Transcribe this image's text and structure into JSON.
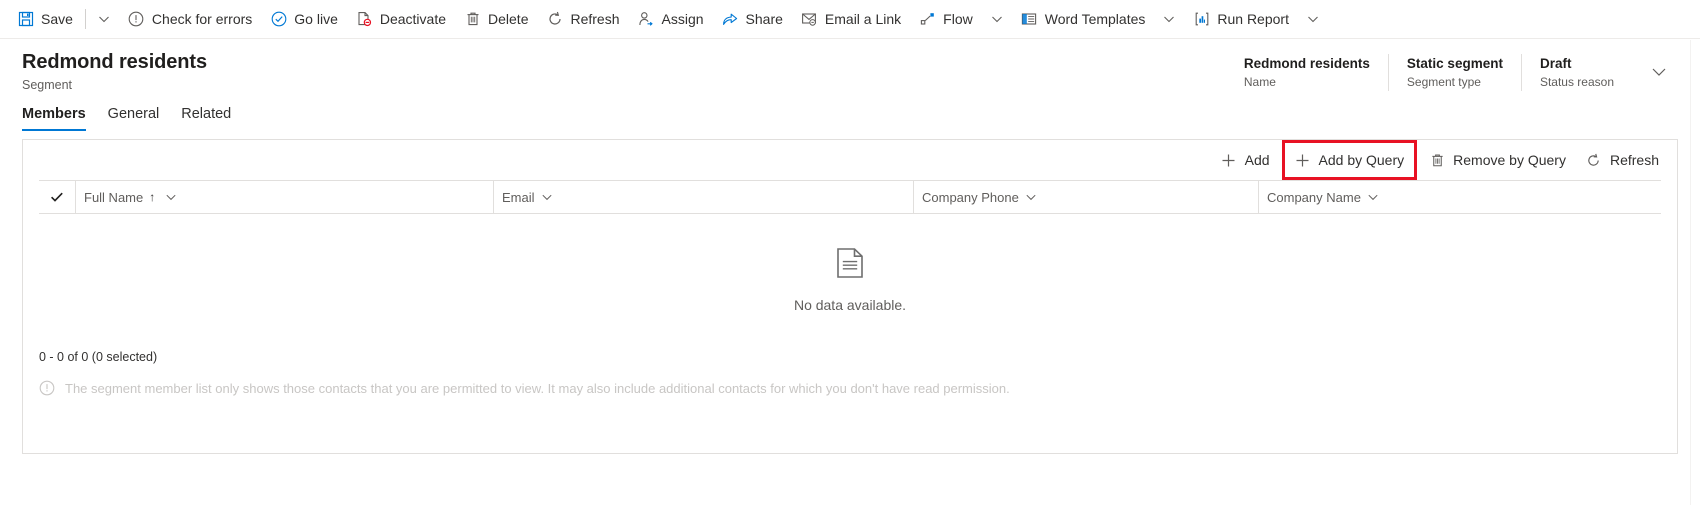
{
  "commandbar": {
    "items": [
      {
        "label": "Save",
        "icon": "save-icon"
      },
      {
        "label": "Check for errors",
        "icon": "error-circle-icon"
      },
      {
        "label": "Go live",
        "icon": "checkmark-circle-icon"
      },
      {
        "label": "Deactivate",
        "icon": "deactivate-page-icon"
      },
      {
        "label": "Delete",
        "icon": "trash-icon"
      },
      {
        "label": "Refresh",
        "icon": "refresh-icon"
      },
      {
        "label": "Assign",
        "icon": "assign-person-icon"
      },
      {
        "label": "Share",
        "icon": "share-icon"
      },
      {
        "label": "Email a Link",
        "icon": "email-link-icon"
      },
      {
        "label": "Flow",
        "icon": "flow-icon"
      },
      {
        "label": "Word Templates",
        "icon": "word-template-icon"
      },
      {
        "label": "Run Report",
        "icon": "report-chart-icon"
      }
    ]
  },
  "record": {
    "title": "Redmond residents",
    "subtitle": "Segment",
    "header_fields": [
      {
        "value": "Redmond residents",
        "label": "Name"
      },
      {
        "value": "Static segment",
        "label": "Segment type"
      },
      {
        "value": "Draft",
        "label": "Status reason"
      }
    ]
  },
  "tabs": [
    {
      "label": "Members",
      "active": true
    },
    {
      "label": "General",
      "active": false
    },
    {
      "label": "Related",
      "active": false
    }
  ],
  "grid": {
    "commands": [
      {
        "label": "Add",
        "icon": "plus-icon",
        "highlighted": false
      },
      {
        "label": "Add by Query",
        "icon": "plus-icon",
        "highlighted": true
      },
      {
        "label": "Remove by Query",
        "icon": "trash-icon",
        "highlighted": false
      },
      {
        "label": "Refresh",
        "icon": "refresh-icon",
        "highlighted": false
      }
    ],
    "columns": [
      {
        "label": "Full Name",
        "sorted": true,
        "sort_direction": "asc"
      },
      {
        "label": "Email",
        "sorted": false,
        "sort_direction": ""
      },
      {
        "label": "Company Phone",
        "sorted": false,
        "sort_direction": ""
      },
      {
        "label": "Company Name",
        "sorted": false,
        "sort_direction": ""
      }
    ],
    "rows": [],
    "empty_text": "No data available.",
    "pager_text": "0 - 0 of 0 (0 selected)",
    "notice_text": "The segment member list only shows those contacts that you are permitted to view. It may also include additional contacts for which you don't have read permission."
  },
  "colors": {
    "accent": "#0078d4",
    "highlight": "#e81123",
    "text": "#323130",
    "muted": "#605e5c",
    "border": "#e1dfdd"
  }
}
